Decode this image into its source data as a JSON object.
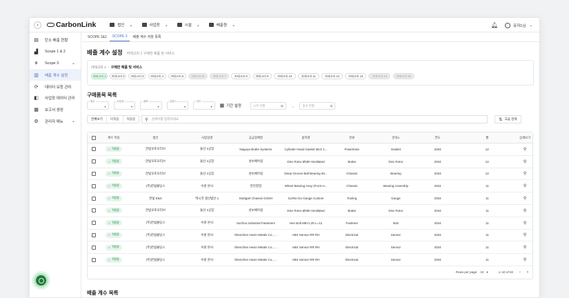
{
  "header": {
    "logo_text": "CarbonLink",
    "nav": [
      {
        "label": "법인",
        "icon": "building-icon"
      },
      {
        "label": "사업장",
        "icon": "factory-icon"
      },
      {
        "label": "시설",
        "icon": "facility-icon"
      },
      {
        "label": "배출원",
        "icon": "cloud-icon"
      }
    ],
    "user_name": "유저1님"
  },
  "sidebar": {
    "items": [
      {
        "label": "탄소 배출 현황",
        "icon": "dashboard-icon",
        "active": false,
        "chevron": false
      },
      {
        "label": "Scope 1 & 2",
        "icon": "chart-icon",
        "active": false,
        "chevron": false
      },
      {
        "label": "Scope 3",
        "icon": "network-icon",
        "active": false,
        "chevron": true
      },
      {
        "label": "배출 계수 설정",
        "icon": "document-icon",
        "active": true,
        "chevron": false
      },
      {
        "label": "데이터 요청 관리",
        "icon": "request-icon",
        "active": false,
        "chevron": false
      },
      {
        "label": "사업장 데이터 관리",
        "icon": "data-icon",
        "active": false,
        "chevron": false
      },
      {
        "label": "보고서 생성",
        "icon": "report-icon",
        "active": false,
        "chevron": false
      },
      {
        "label": "관리자 메뉴",
        "icon": "admin-icon",
        "active": false,
        "chevron": true
      }
    ]
  },
  "tabs": [
    "SCOPE 1&2",
    "SCOPE 3",
    "배출 계수 저장 목록"
  ],
  "page": {
    "title": "배출 계수 설정",
    "subtitle": "카테고리 1 구매한 제품 및 서비스"
  },
  "category": {
    "path_prefix": "카테고리 1",
    "path_name": "구매한 제품 및 서비스",
    "chips": [
      {
        "label": "카테고리 1",
        "state": "active"
      },
      {
        "label": "카테고리 2",
        "state": "normal"
      },
      {
        "label": "카테고리 3",
        "state": "normal"
      },
      {
        "label": "카테고리 4",
        "state": "normal"
      },
      {
        "label": "카테고리 5",
        "state": "normal"
      },
      {
        "label": "카테고리 6",
        "state": "disabled"
      },
      {
        "label": "카테고리 7",
        "state": "disabled"
      },
      {
        "label": "카테고리 8",
        "state": "normal"
      },
      {
        "label": "카테고리 9",
        "state": "normal"
      },
      {
        "label": "카테고리 10",
        "state": "normal"
      },
      {
        "label": "카테고리 11",
        "state": "normal"
      },
      {
        "label": "카테고리 12",
        "state": "normal"
      },
      {
        "label": "카테고리 13",
        "state": "normal"
      },
      {
        "label": "카테고리 14",
        "state": "disabled"
      },
      {
        "label": "카테고리 15",
        "state": "disabled"
      }
    ]
  },
  "list": {
    "title": "구매품목 목록",
    "filters": [
      "법인",
      "사업장",
      "품목",
      "분류1",
      "연도"
    ],
    "period_label": "기간 설정",
    "start_placeholder": "시작 연월",
    "end_placeholder": "종료 연월",
    "segments": [
      "전체보기",
      "미적용",
      "적용중"
    ],
    "search_placeholder": "검색어를 입력하세요",
    "advanced_label": "고급 검색",
    "columns": [
      "계수 적용",
      "법인",
      "사업장명",
      "공급업체명",
      "품목명",
      "분류",
      "분류1",
      "연도",
      "월",
      "상세보기"
    ],
    "rows": [
      {
        "status": "적용중",
        "corp": "한빛모토모티브",
        "site": "울산 2공장",
        "supplier": "Nagoya Brake Systems",
        "item": "Cylinder Head Gasket MLS 1...",
        "cls": "Powertrain",
        "cls1": "Gasket",
        "year": "2024",
        "month": "12"
      },
      {
        "status": "적용중",
        "corp": "한빛모토모티브",
        "site": "울산 2공장",
        "supplier": "성보베어링",
        "item": "Disc Rotor Ø280 Ventilated",
        "cls": "Brake",
        "cls1": "Disc Rotor",
        "year": "2024",
        "month": "12"
      },
      {
        "status": "적용중",
        "corp": "한빛모토모티브",
        "site": "울산 2공장",
        "supplier": "성보베어링",
        "item": "Deep Groove Ball Bearing 60...",
        "cls": "Chassis",
        "cls1": "Bearing",
        "year": "2024",
        "month": "12"
      },
      {
        "status": "적용중",
        "corp": "(주)한빛몰딩스",
        "site": "수원 본사",
        "supplier": "한진정밀",
        "item": "Wheel Bearing Assy (Front H...",
        "cls": "Chassis",
        "cls1": "Bearing Assembly",
        "year": "2024",
        "month": "11"
      },
      {
        "status": "적용중",
        "corp": "한빛 E&S",
        "site": "멕시코 생산법인 1",
        "supplier": "Stuttgart Chassis GmbH",
        "item": "Go/No-Go Gauge Custom",
        "cls": "Tooling",
        "cls1": "Gauge",
        "year": "2024",
        "month": "11"
      },
      {
        "status": "적용중",
        "corp": "한빛모토모티브",
        "site": "울산 2공장",
        "supplier": "성보베어링",
        "item": "Disc Rotor Ø280 Ventilated",
        "cls": "Brake",
        "cls1": "Disc Rotor",
        "year": "2024",
        "month": "11"
      },
      {
        "status": "적용중",
        "corp": "(주)한빛몰딩스",
        "site": "수원 본사",
        "supplier": "Suzhou Industrial Fasteners",
        "item": "Hex Bolt M8×1.25 L=12",
        "cls": "Fastener",
        "cls1": "Bolt",
        "year": "2024",
        "month": "11"
      },
      {
        "status": "적용중",
        "corp": "(주)한빛몰딩스",
        "site": "수원 본사",
        "supplier": "Shenzhen Hexin Metals Co., ...",
        "item": "ABS Sensor RR RH",
        "cls": "Electrical",
        "cls1": "Sensor",
        "year": "2024",
        "month": "11"
      },
      {
        "status": "적용중",
        "corp": "(주)한빛몰딩스",
        "site": "수원 본사",
        "supplier": "Shenzhen Hexin Metals Co., ...",
        "item": "ABS Sensor RR RH",
        "cls": "Electrical",
        "cls1": "Sensor",
        "year": "2024",
        "month": "11"
      },
      {
        "status": "적용중",
        "corp": "(주)한빛몰딩스",
        "site": "수원 본사",
        "supplier": "Shenzhen Hexin Metals Co., ...",
        "item": "ABS Sensor RR RH",
        "cls": "Electrical",
        "cls1": "Sensor",
        "year": "2024",
        "month": "11"
      }
    ],
    "pager": {
      "rows_per_page_label": "Rows per page:",
      "rows_per_page": "10",
      "range": "1–10 of 92"
    }
  },
  "bottom_title": "배출 계수 목록",
  "colors": {
    "accent": "#4a72b8",
    "active_green": "#1e8a45",
    "badge_bg": "#e4f5ea",
    "fab": "#1f7a3a"
  }
}
